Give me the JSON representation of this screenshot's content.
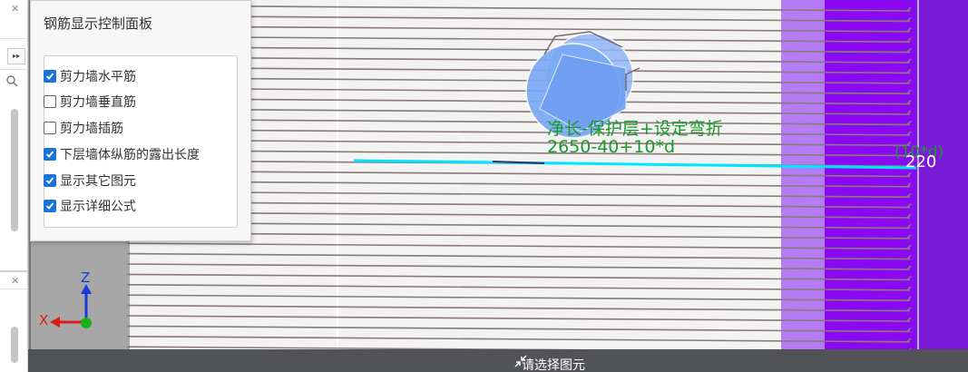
{
  "panel": {
    "title": "钢筋显示控制面板",
    "options": [
      {
        "label": "剪力墙水平筋",
        "checked": true
      },
      {
        "label": "剪力墙垂直筋",
        "checked": false
      },
      {
        "label": "剪力墙插筋",
        "checked": false
      },
      {
        "label": "下层墙体纵筋的露出长度",
        "checked": true
      },
      {
        "label": "显示其它图元",
        "checked": true
      },
      {
        "label": "显示详细公式",
        "checked": true
      }
    ]
  },
  "canvas": {
    "formula_label": "净长-保护层+设定弯折",
    "formula_value": "2650-40+10*d",
    "dim_label": "(10*d)",
    "dim_value": "220",
    "axis_x": "X",
    "axis_z": "Z"
  },
  "status": {
    "prompt": "请选择图元"
  },
  "colors": {
    "rebar_gray": "#8a7a78",
    "highlight_rebar": "#00e5ff",
    "purple_light": "#b57cf5",
    "purple_dark": "#8a08f2",
    "purple_edge": "#7a1bd8",
    "sphere": "#7aa8f5",
    "formula_green": "#1a9a2a",
    "checkbox_blue": "#1a73d9"
  },
  "icons": {
    "shrink": "shrink-arrows-icon",
    "close": "close-icon",
    "search": "search-icon",
    "expand": "double-chevron-right-icon",
    "check": "check-icon"
  }
}
